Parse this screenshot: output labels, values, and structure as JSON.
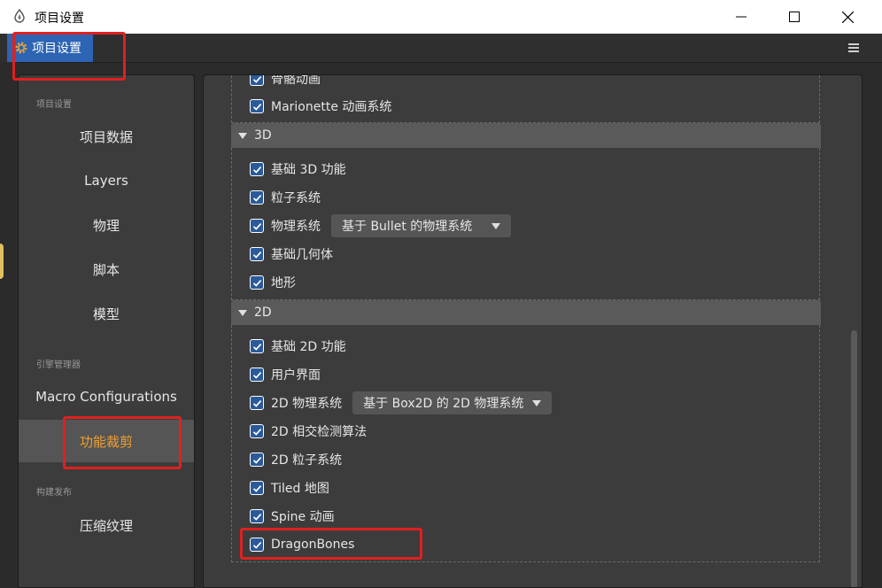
{
  "window": {
    "title": "项目设置"
  },
  "header": {
    "tab_label": "项目设置"
  },
  "sidebar": {
    "sections": [
      {
        "label": "项目设置",
        "items": [
          "项目数据",
          "Layers",
          "物理",
          "脚本",
          "模型"
        ]
      },
      {
        "label": "引擎管理器",
        "items": [
          "Macro Configurations",
          "功能裁剪"
        ]
      },
      {
        "label": "构建发布",
        "items": [
          "压缩纹理"
        ]
      }
    ],
    "active_item": "功能裁剪"
  },
  "content": {
    "top_rows": [
      {
        "label": "骨骼动画",
        "checked": true
      },
      {
        "label": "Marionette 动画系统",
        "checked": true
      }
    ],
    "groups": [
      {
        "title": "3D",
        "rows": [
          {
            "label": "基础 3D 功能",
            "checked": true
          },
          {
            "label": "粒子系统",
            "checked": true
          },
          {
            "label": "物理系统",
            "checked": true,
            "select": "基于 Bullet 的物理系统"
          },
          {
            "label": "基础几何体",
            "checked": true
          },
          {
            "label": "地形",
            "checked": true
          }
        ]
      },
      {
        "title": "2D",
        "rows": [
          {
            "label": "基础 2D 功能",
            "checked": true
          },
          {
            "label": "用户界面",
            "checked": true
          },
          {
            "label": "2D 物理系统",
            "checked": true,
            "select": "基于 Box2D 的 2D 物理系统"
          },
          {
            "label": "2D 相交检测算法",
            "checked": true
          },
          {
            "label": "2D 粒子系统",
            "checked": true
          },
          {
            "label": "Tiled 地图",
            "checked": true
          },
          {
            "label": "Spine 动画",
            "checked": true
          },
          {
            "label": "DragonBones",
            "checked": true
          }
        ]
      }
    ]
  },
  "icons": {
    "app": "app-logo-icon",
    "settings": "gear-icon",
    "menu": "hamburger-menu-icon",
    "check": "checkmark-icon",
    "dropdown": "triangle-down-icon",
    "collapse": "triangle-down-icon"
  },
  "colors": {
    "accent": "#2d64b4",
    "active_text": "#f0a030",
    "annotation": "#e02020",
    "checkbox_fill": "#2a5a9a"
  }
}
